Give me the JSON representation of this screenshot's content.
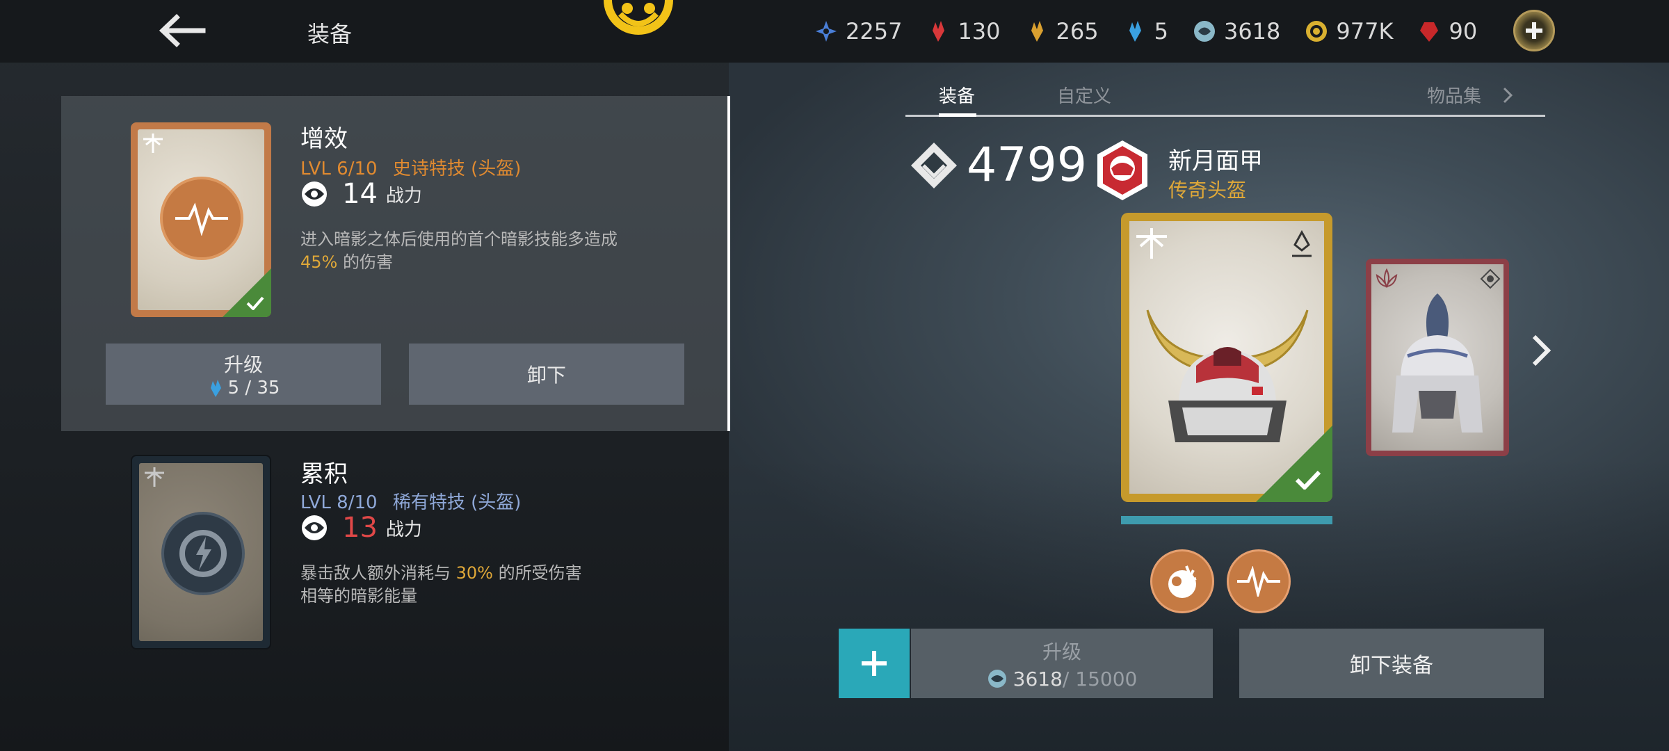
{
  "header": {
    "title": "装备",
    "currencies": [
      {
        "icon": "blue-star-icon",
        "value": "2257",
        "color": "#4a7fd8"
      },
      {
        "icon": "red-crystal-icon",
        "value": "130",
        "color": "#d8383a"
      },
      {
        "icon": "gold-crystal-icon",
        "value": "265",
        "color": "#d9a030"
      },
      {
        "icon": "blue-crystal-icon",
        "value": "5",
        "color": "#3aa0e0"
      },
      {
        "icon": "swirl-orb-icon",
        "value": "3618",
        "color": "#8ab8c8"
      },
      {
        "icon": "gold-coin-icon",
        "value": "977K",
        "color": "#d9b030"
      },
      {
        "icon": "ruby-icon",
        "value": "90",
        "color": "#c8282a"
      }
    ]
  },
  "perks": [
    {
      "name": "增效",
      "level": "LVL  6/10",
      "rarity": "史诗特技 (头盔)",
      "rarity_color": "#e08a30",
      "power": "14",
      "power_color": "#ffffff",
      "power_label": "战力",
      "desc_line1": "进入暗影之体后使用的首个暗影技能多造成",
      "desc_highlight": "45%",
      "desc_tail": " 的伤害",
      "equipped": true
    },
    {
      "name": "累积",
      "level": "LVL  8/10",
      "rarity": "稀有特技 (头盔)",
      "rarity_color": "#8fa8d8",
      "power": "13",
      "power_color": "#e04848",
      "power_label": "战力",
      "desc_pre": "暴击敌人额外消耗与 ",
      "desc_highlight": "30%",
      "desc_post": " 的所受伤害",
      "desc_line2": "相等的暗影能量"
    }
  ],
  "perk_actions": {
    "upgrade_label": "升级",
    "upgrade_cost": "5 / 35",
    "unequip_label": "卸下"
  },
  "tabs": [
    {
      "label": "装备",
      "active": true
    },
    {
      "label": "自定义",
      "active": false
    },
    {
      "label": "物品集",
      "active": false
    }
  ],
  "item": {
    "power": "4799",
    "name": "新月面甲",
    "rarity": "传奇头盔"
  },
  "gear_actions": {
    "upgrade_label": "升级",
    "cost_current": "3618",
    "cost_total": " / 15000",
    "unequip_label": "卸下装备"
  }
}
